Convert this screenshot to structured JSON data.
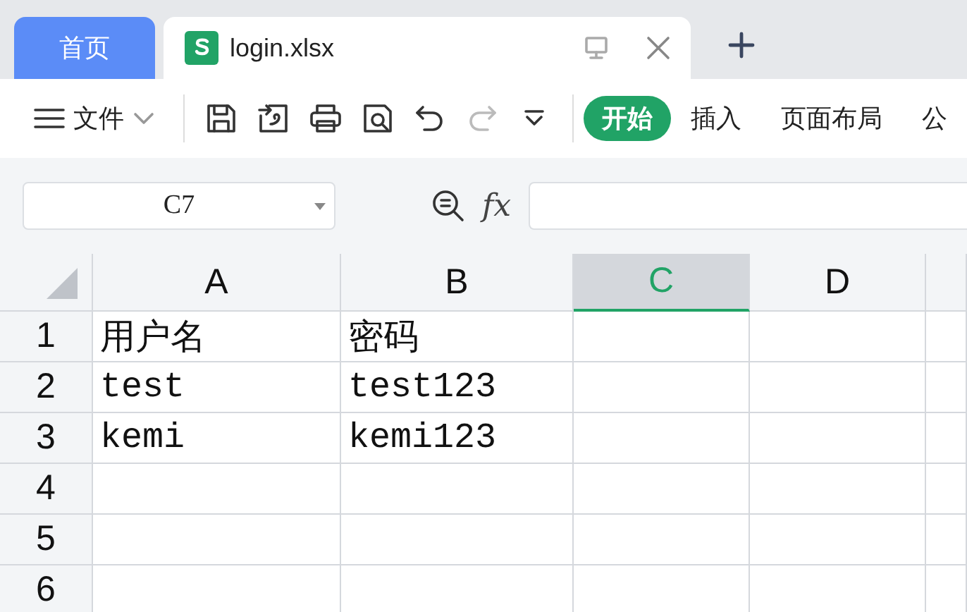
{
  "tabs": [
    {
      "label": "首页",
      "kind": "home",
      "selected": false
    },
    {
      "label": "login.xlsx",
      "kind": "file",
      "selected": true
    }
  ],
  "toolbar": {
    "file_menu": "文件",
    "redo": {
      "disabled": true
    },
    "ribbon_tabs": [
      {
        "label": "开始",
        "selected": true
      },
      {
        "label": "插入",
        "selected": false
      },
      {
        "label": "页面布局",
        "selected": false
      },
      {
        "label": "公",
        "selected": false
      }
    ]
  },
  "formula_bar": {
    "name_box": "C7",
    "fx_label": "fx"
  },
  "sheet": {
    "columns": [
      {
        "label": "A",
        "selected": false
      },
      {
        "label": "B",
        "selected": false
      },
      {
        "label": "C",
        "selected": true
      },
      {
        "label": "D",
        "selected": false
      }
    ],
    "rows": [
      {
        "header": "1",
        "cells": [
          "用户名",
          "密码"
        ]
      },
      {
        "header": "2",
        "cells": [
          "test",
          "test123"
        ]
      },
      {
        "header": "3",
        "cells": [
          "kemi",
          "kemi123"
        ]
      },
      {
        "header": "4"
      },
      {
        "header": "5"
      },
      {
        "header": "6"
      }
    ]
  }
}
